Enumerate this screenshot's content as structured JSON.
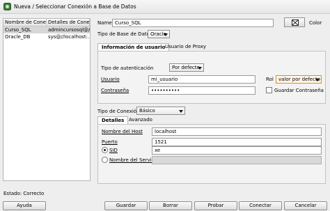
{
  "window": {
    "title": "Nueva / Seleccionar Conexión a Base de Datos"
  },
  "connections": {
    "columns": [
      "Nombre de Conex...",
      "Detalles de Cone..."
    ],
    "rows": [
      {
        "name": "Curso_SQL",
        "details": "admincursosql@//..."
      },
      {
        "name": "Oracle_DB",
        "details": "sys@//localhost:..."
      }
    ]
  },
  "form": {
    "name_label": "Name",
    "name_value": "Curso_SQL",
    "color_label": "Color",
    "db_type_label": "Tipo de Base de Datos",
    "db_type_value": "Oracle",
    "tabs": [
      "Información de usuario",
      "Usuario de Proxy"
    ],
    "auth_type_label": "Tipo de autenticación",
    "auth_type_value": "Por defecto",
    "user_label": "Usuario",
    "user_value": "mi_usuario",
    "role_label": "Rol",
    "role_value": "valor por defecto",
    "password_label": "Contraseña",
    "password_value": "••••••••••",
    "save_password_label": "Guardar Contraseña",
    "conn_type_label": "Tipo de Conexión",
    "conn_type_value": "Básico",
    "detail_tabs": [
      "Detalles",
      "Avanzado"
    ],
    "host_label": "Nombre del Host",
    "host_value": "localhost",
    "port_label": "Puerto",
    "port_value": "1521",
    "sid_label": "SID",
    "sid_value": "xe",
    "service_label": "Nombre del Servicio",
    "service_value": ""
  },
  "status": "Estado: Correcto",
  "buttons": {
    "help": "Ayuda",
    "save": "Guardar",
    "delete": "Borrar",
    "test": "Probar",
    "connect": "Conectar",
    "cancel": "Cancelar"
  },
  "colors": {
    "role_border": "#e08a1e"
  }
}
